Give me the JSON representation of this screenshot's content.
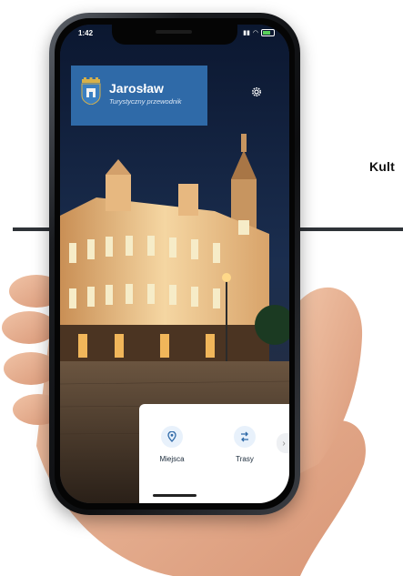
{
  "page": {
    "side_text": "Kult"
  },
  "status_bar": {
    "time": "1:42"
  },
  "app": {
    "title": "Jarosław",
    "subtitle": "Turystyczny przewodnik"
  },
  "bottom_nav": {
    "items": [
      {
        "label": "Miejsca",
        "icon": "location-pin-icon"
      },
      {
        "label": "Trasy",
        "icon": "route-icon"
      }
    ]
  },
  "colors": {
    "header_blue": "#2f6aa8",
    "nav_icon": "#2f6aa8",
    "rule": "#2f3338"
  }
}
